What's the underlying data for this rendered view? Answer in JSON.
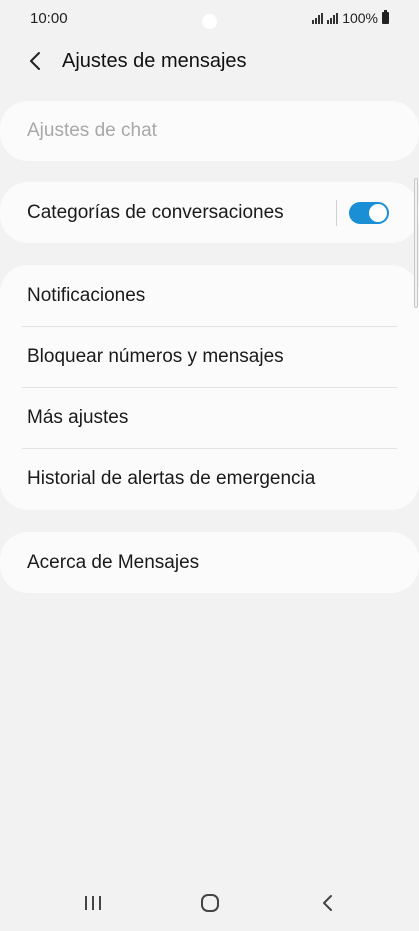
{
  "status_bar": {
    "time": "10:00",
    "battery": "100%"
  },
  "header": {
    "title": "Ajustes de mensajes",
    "back_icon": "chevron-left-icon"
  },
  "settings": {
    "chat_settings": "Ajustes de chat",
    "conversation_categories": {
      "label": "Categorías de conversaciones",
      "enabled": true
    },
    "items": [
      {
        "label": "Notificaciones"
      },
      {
        "label": "Bloquear números y mensajes"
      },
      {
        "label": "Más ajustes"
      },
      {
        "label": "Historial de alertas de emergencia"
      }
    ],
    "about": "Acerca de Mensajes"
  },
  "nav_bar": {
    "recent_icon": "recent-apps-icon",
    "home_icon": "home-icon",
    "back_icon": "back-icon"
  },
  "colors": {
    "background": "#f2f2f2",
    "card": "#fbfbfb",
    "accent": "#1a8fd6",
    "disabled_text": "#a8a8a8"
  }
}
